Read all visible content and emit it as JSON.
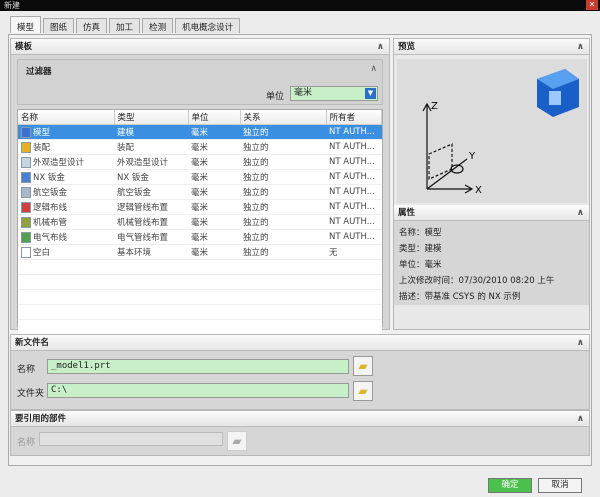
{
  "window": {
    "title": "新建",
    "close": "✕"
  },
  "tabs": [
    "模型",
    "图纸",
    "仿真",
    "加工",
    "检测",
    "机电概念设计"
  ],
  "template": {
    "title": "模板",
    "filter": {
      "title": "过滤器",
      "unit_label": "单位",
      "unit_value": "毫米"
    },
    "columns": [
      "名称",
      "类型",
      "单位",
      "关系",
      "所有者"
    ],
    "rows": [
      {
        "name": "模型",
        "type": "建模",
        "unit": "毫米",
        "rel": "独立的",
        "owner": "NT AUTH..."
      },
      {
        "name": "装配",
        "type": "装配",
        "unit": "毫米",
        "rel": "独立的",
        "owner": "NT AUTH..."
      },
      {
        "name": "外观造型设计",
        "type": "外观造型设计",
        "unit": "毫米",
        "rel": "独立的",
        "owner": "NT AUTH..."
      },
      {
        "name": "NX 钣金",
        "type": "NX 钣金",
        "unit": "毫米",
        "rel": "独立的",
        "owner": "NT AUTH..."
      },
      {
        "name": "航空钣金",
        "type": "航空钣金",
        "unit": "毫米",
        "rel": "独立的",
        "owner": "NT AUTH..."
      },
      {
        "name": "逻辑布线",
        "type": "逻辑管线布置",
        "unit": "毫米",
        "rel": "独立的",
        "owner": "NT AUTH..."
      },
      {
        "name": "机械布管",
        "type": "机械管线布置",
        "unit": "毫米",
        "rel": "独立的",
        "owner": "NT AUTH..."
      },
      {
        "name": "电气布线",
        "type": "电气管线布置",
        "unit": "毫米",
        "rel": "独立的",
        "owner": "NT AUTH..."
      },
      {
        "name": "空白",
        "type": "基本环境",
        "unit": "毫米",
        "rel": "独立的",
        "owner": "无"
      }
    ]
  },
  "preview": {
    "title": "预览",
    "axes": {
      "z": "Z",
      "y": "Y",
      "x": "X"
    }
  },
  "properties": {
    "title": "属性",
    "lines": [
      "名称：模型",
      "类型：建模",
      "单位：毫米",
      "上次修改时间：07/30/2010 08:20 上午",
      "描述：带基准 CSYS 的 NX 示例"
    ]
  },
  "new_file": {
    "title": "新文件名",
    "name_label": "名称",
    "name_value": "_model1.prt",
    "folder_label": "文件夹",
    "folder_value": "C:\\"
  },
  "ref_parts": {
    "title": "要引用的部件",
    "name_label": "名称",
    "name_value": ""
  },
  "buttons": {
    "ok": "确定",
    "cancel": "取消"
  },
  "colors": {
    "selection": "#3b8fe0",
    "input_bg": "#c8f0c8",
    "ok": "#4cc04c"
  }
}
